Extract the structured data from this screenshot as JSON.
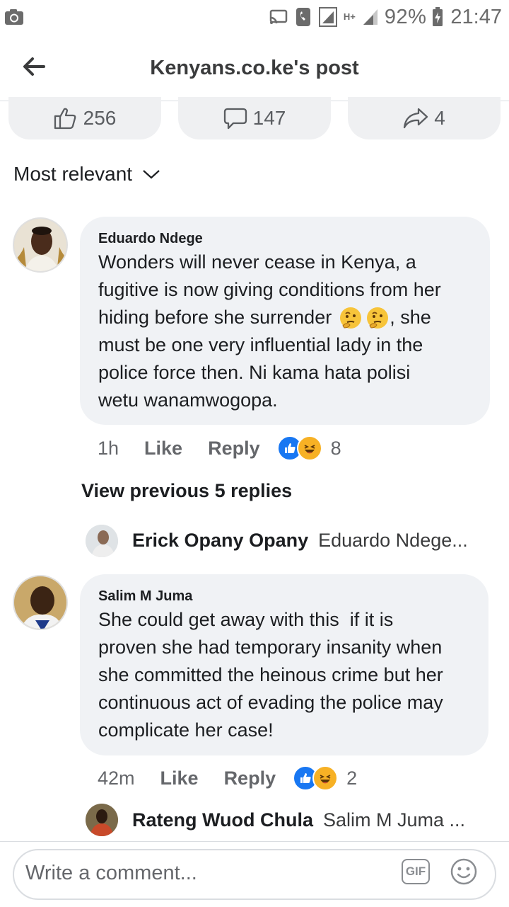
{
  "status_bar": {
    "network": "H+",
    "battery": "92%",
    "time": "21:47"
  },
  "header": {
    "title": "Kenyans.co.ke's post"
  },
  "post_stats": {
    "likes": "256",
    "comments": "147",
    "shares": "4"
  },
  "sort": {
    "label": "Most relevant"
  },
  "comments": [
    {
      "author": "Eduardo Ndege",
      "lines": [
        "Wonders will never cease in Kenya, a",
        "fugitive is now giving conditions from her",
        "hiding before she surrender",
        "must be one very influential lady in the",
        "police force then. Ni kama hata polisi",
        "wetu wanamwogopa."
      ],
      "line3_tail": ", she",
      "time": "1h",
      "like_label": "Like",
      "reply_label": "Reply",
      "reaction_count": "8"
    },
    {
      "author": "Salim M Juma",
      "lines": [
        "She could get away with this  if it is",
        "proven she had temporary insanity when",
        "she committed the heinous crime but her",
        "continuous act of evading the police may",
        "complicate her case!"
      ],
      "time": "42m",
      "like_label": "Like",
      "reply_label": "Reply",
      "reaction_count": "2"
    }
  ],
  "view_previous": "View previous 5 replies",
  "replies": [
    {
      "author": "Erick Opany Opany",
      "preview": "Eduardo Ndege..."
    },
    {
      "author": "Rateng Wuod Chula",
      "preview": "Salim M Juma ..."
    }
  ],
  "composer": {
    "placeholder": "Write a comment...",
    "gif_label": "GIF"
  },
  "colors": {
    "like_blue": "#1877f2",
    "haha_yellow": "#f7b125",
    "bubble_bg": "#f0f2f5",
    "secondary_text": "#65676b"
  },
  "icons": [
    "camera-icon",
    "cast-icon",
    "call-icon",
    "signal-icon",
    "battery-icon",
    "back-arrow-icon",
    "thumbs-up-icon",
    "comment-icon",
    "share-icon",
    "chevron-down-icon",
    "gif-icon",
    "emoji-icon"
  ]
}
